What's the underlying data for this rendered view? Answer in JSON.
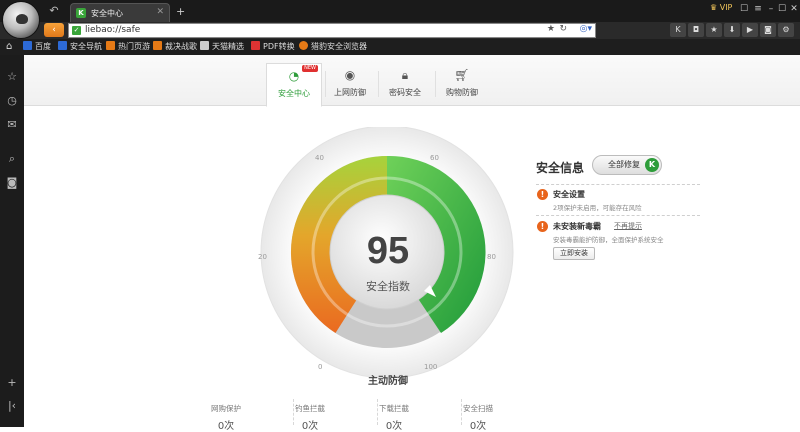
{
  "browser": {
    "tab_title": "安全中心",
    "tab_favicon": "K",
    "new_tab": "+",
    "vip": "VIP",
    "url": "liebao://safe"
  },
  "bookmarks": [
    {
      "label": "百度",
      "color": "#2d6ad6"
    },
    {
      "label": "安全导航",
      "color": "#2d6ad6"
    },
    {
      "label": "热门页游",
      "color": "#e67a16"
    },
    {
      "label": "裁决战歌",
      "color": "#e67a16"
    },
    {
      "label": "天猫精选",
      "color": "#cccccc"
    },
    {
      "label": "PDF转换",
      "color": "#d33"
    },
    {
      "label": "猎豹安全浏览器",
      "color": "#e67a16"
    }
  ],
  "nav_tabs": [
    {
      "label": "安全中心",
      "icon": "gauge-icon",
      "badge": "NEW"
    },
    {
      "label": "上网防御",
      "icon": "shield-icon"
    },
    {
      "label": "密码安全",
      "icon": "lock-icon"
    },
    {
      "label": "购物防御",
      "icon": "cart-icon"
    }
  ],
  "gauge": {
    "score": "95",
    "score_label": "安全指数",
    "bottom_label": "主动防御",
    "ticks": [
      "0",
      "20",
      "40",
      "60",
      "80",
      "100"
    ]
  },
  "info": {
    "title": "安全信息",
    "fix_button": "全部修复",
    "items": [
      {
        "title": "安全设置",
        "desc": "2项保护未启用，可能存在风险"
      },
      {
        "title": "未安装新毒霸",
        "desc": "安装毒霸能护防御，全面保护系统安全",
        "dismiss": "不再提示",
        "action": "立即安装"
      }
    ]
  },
  "stats": [
    {
      "label": "网购保护",
      "value": "0次"
    },
    {
      "label": "钓鱼拦截",
      "value": "0次"
    },
    {
      "label": "下载拦截",
      "value": "0次"
    },
    {
      "label": "安全扫描",
      "value": "0次"
    }
  ],
  "colors": {
    "accent": "#2e9d3a",
    "warning": "#e8641c",
    "browser_chrome": "#1a1a1a"
  }
}
